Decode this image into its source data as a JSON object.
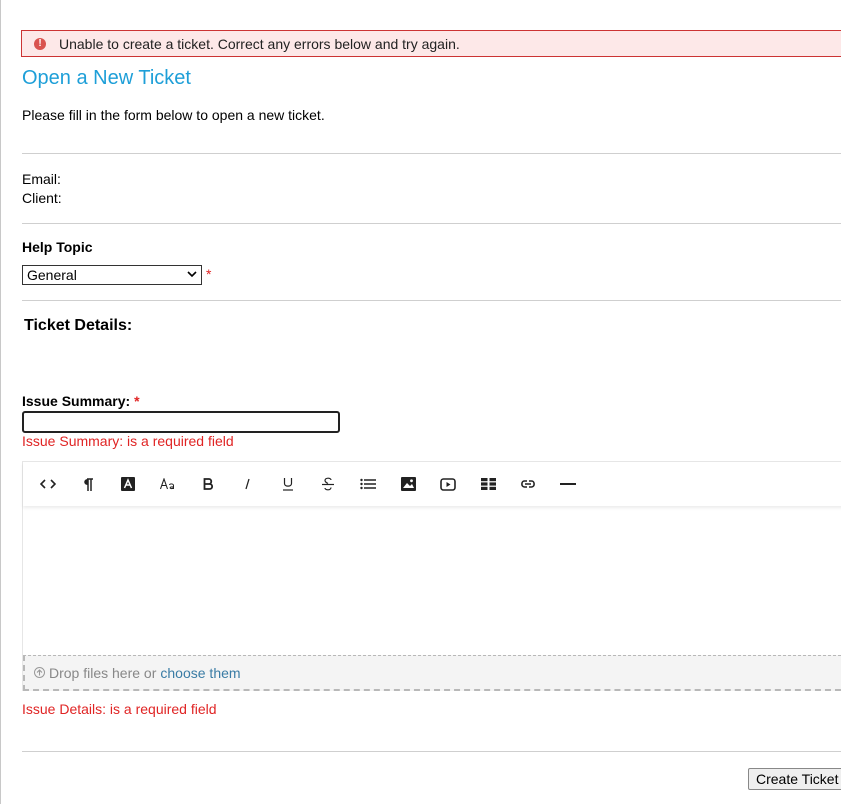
{
  "banner": {
    "message": "Unable to create a ticket. Correct any errors below and try again.",
    "icon": "alert-circle-icon"
  },
  "page": {
    "title": "Open a New Ticket",
    "intro": "Please fill in the form below to open a new ticket."
  },
  "user": {
    "email_label": "Email:",
    "client_label": "Client:"
  },
  "help_topic": {
    "label": "Help Topic",
    "selected": "General",
    "required_mark": "*"
  },
  "ticket_details": {
    "heading": "Ticket Details:"
  },
  "issue_summary": {
    "label": "Issue Summary:",
    "required_mark": "*",
    "value": "",
    "error": "Issue Summary: is a required field"
  },
  "editor": {
    "toolbar": [
      "code-view-icon",
      "paragraph-icon",
      "text-color-icon",
      "font-size-icon",
      "bold-icon",
      "italic-icon",
      "underline-icon",
      "strikethrough-icon",
      "list-icon",
      "image-icon",
      "video-icon",
      "table-icon",
      "link-icon",
      "horizontal-rule-icon"
    ],
    "dropzone_text": "Drop files here or",
    "dropzone_link": "choose them",
    "error": "Issue Details: is a required field"
  },
  "actions": {
    "submit_label": "Create Ticket"
  },
  "colors": {
    "title": "#1e9fd8",
    "error": "#e02424",
    "banner_bg": "#fde8e8",
    "banner_border": "#cc3333",
    "link": "#3a7ca5"
  }
}
